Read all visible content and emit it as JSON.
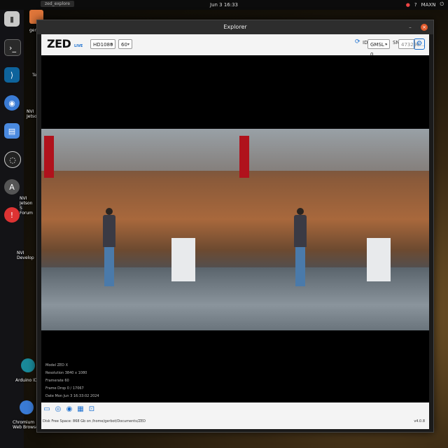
{
  "topbar": {
    "tab_label": "zed_explore",
    "clock": "Jun 3  16:33",
    "tray_user": "MAXN"
  },
  "dock": {
    "items": [
      {
        "name": "files-icon"
      },
      {
        "name": "terminal-icon"
      },
      {
        "name": "vscode-icon"
      },
      {
        "name": "chromium-icon"
      },
      {
        "name": "editor-icon"
      },
      {
        "name": "obs-icon"
      },
      {
        "name": "software-icon"
      },
      {
        "name": "help-icon"
      }
    ]
  },
  "desktop": {
    "labels": [
      "gerbot",
      "Te",
      "NVI Jetso",
      "NVI Jetson S Forum",
      "NVI Develop",
      "Arduino IDE",
      "Chromium Web Browser"
    ]
  },
  "window": {
    "title": "Explorer",
    "toolbar": {
      "logo": "ZED",
      "logo_sub": "LIVE",
      "resolution": "HD1080",
      "fps": "60",
      "camera_id_label": "ID",
      "camera_select": "GMSL - 0",
      "sn_label": "SN",
      "sn_value": "473296..."
    },
    "info": {
      "model": "Model   ZED X",
      "resolution": "Resolution   3840 x 1080",
      "framerate": "Framerate   60",
      "frame_drop": "Frame Drop   0 / 17067",
      "date": "Date   Mon Jun 3 16:33:02 2024"
    },
    "status": {
      "disk_text": "Disk Free Space: 868 Gb  on /home/gerbot/Documents/ZED",
      "version": "v4.0.8"
    }
  },
  "colors": {
    "accent": "#1a6fd0",
    "close": "#e25b2c"
  }
}
